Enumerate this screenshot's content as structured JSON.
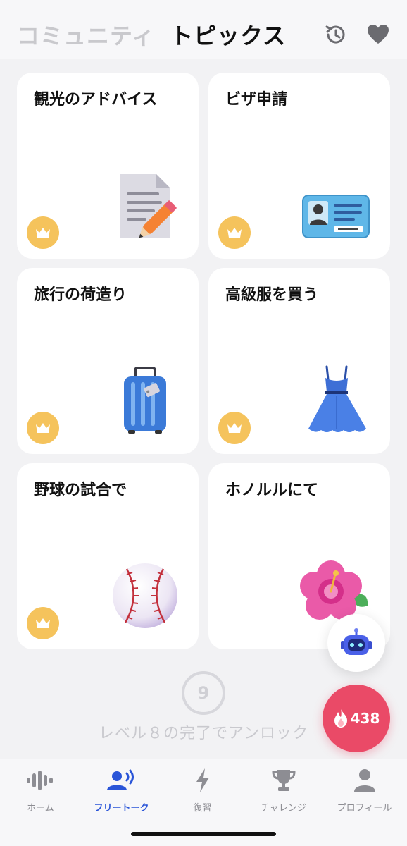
{
  "header": {
    "tab_community": "コミュニティ",
    "tab_topics": "トピックス",
    "icons": [
      "history-icon",
      "heart-icon"
    ]
  },
  "topics": [
    {
      "title": "観光のアドバイス",
      "icon": "document-pencil-icon",
      "locked": true
    },
    {
      "title": "ビザ申請",
      "icon": "id-card-icon",
      "locked": true
    },
    {
      "title": "旅行の荷造り",
      "icon": "suitcase-icon",
      "locked": true
    },
    {
      "title": "高級服を買う",
      "icon": "dress-icon",
      "locked": true
    },
    {
      "title": "野球の試合で",
      "icon": "baseball-icon",
      "locked": true
    },
    {
      "title": "ホノルルにて",
      "icon": "hibiscus-icon",
      "locked": false
    }
  ],
  "unlock": {
    "level_number": "9",
    "message": "レベル８の完了でアンロック"
  },
  "streak": {
    "count": "438"
  },
  "nav": {
    "items": [
      {
        "label": "ホーム",
        "icon": "waveform-icon"
      },
      {
        "label": "フリートーク",
        "icon": "speaking-person-icon"
      },
      {
        "label": "復習",
        "icon": "lightning-icon"
      },
      {
        "label": "チャレンジ",
        "icon": "trophy-icon"
      },
      {
        "label": "プロフィール",
        "icon": "person-icon"
      }
    ],
    "active": "フリートーク"
  },
  "colors": {
    "accent": "#2a55d8",
    "crown_badge": "#f5c35c",
    "streak": "#ea4a67"
  }
}
